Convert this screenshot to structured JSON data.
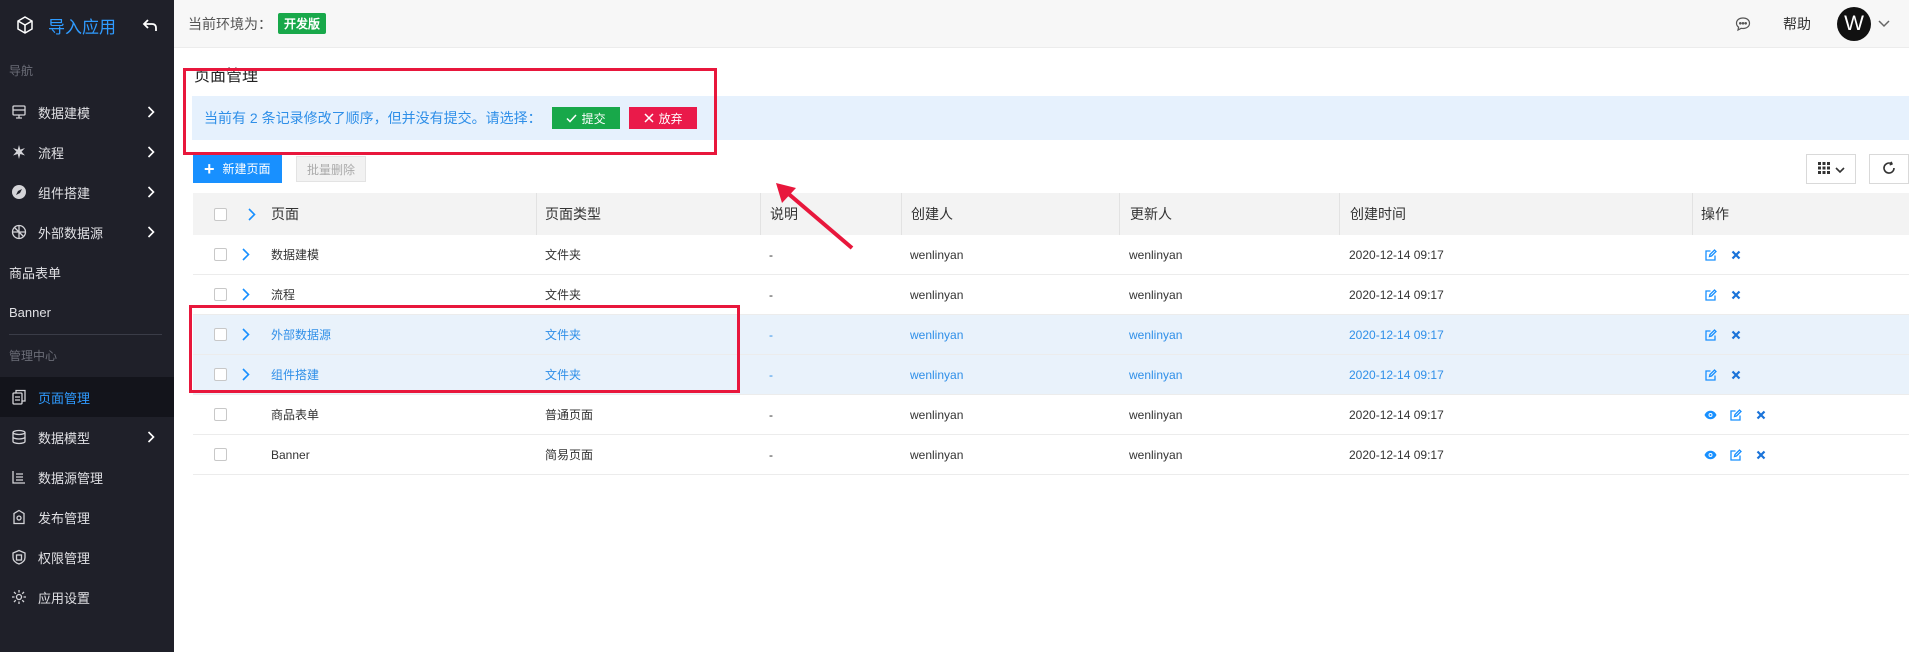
{
  "app": {
    "title": "导入应用"
  },
  "sidebar": {
    "nav_section": "导航",
    "nav_items": [
      {
        "label": "数据建模",
        "icon": "database-model-icon",
        "has_children": true
      },
      {
        "label": "流程",
        "icon": "flow-icon",
        "has_children": true
      },
      {
        "label": "组件搭建",
        "icon": "compass-icon",
        "has_children": true
      },
      {
        "label": "外部数据源",
        "icon": "external-source-icon",
        "has_children": true
      }
    ],
    "plain_items": [
      {
        "label": "商品表单"
      },
      {
        "label": "Banner"
      }
    ],
    "admin_section": "管理中心",
    "admin_items": [
      {
        "label": "页面管理",
        "icon": "pages-icon",
        "active": true,
        "has_children": false
      },
      {
        "label": "数据模型",
        "icon": "database-icon",
        "active": false,
        "has_children": true
      },
      {
        "label": "数据源管理",
        "icon": "datasource-icon",
        "active": false,
        "has_children": false
      },
      {
        "label": "发布管理",
        "icon": "publish-icon",
        "active": false,
        "has_children": false
      },
      {
        "label": "权限管理",
        "icon": "shield-icon",
        "active": false,
        "has_children": false
      },
      {
        "label": "应用设置",
        "icon": "gear-icon",
        "active": false,
        "has_children": false
      }
    ]
  },
  "topbar": {
    "env_label": "当前环境为：",
    "env_badge": "开发版",
    "help": "帮助",
    "avatar_initial": "W"
  },
  "page": {
    "title": "页面管理",
    "notice_text": "当前有 2 条记录修改了顺序，但并没有提交。请选择：",
    "submit_label": "提交",
    "discard_label": "放弃",
    "new_page_label": "新建页面",
    "batch_delete_label": "批量删除"
  },
  "colors": {
    "accent": "#1890ff",
    "submit": "#18a84a",
    "discard": "#ea1a4a",
    "annotation": "#e8173c",
    "sidebar_bg": "#1f2029"
  },
  "table": {
    "columns": [
      "页面",
      "页面类型",
      "说明",
      "创建人",
      "更新人",
      "创建时间",
      "操作"
    ],
    "rows": [
      {
        "name": "数据建模",
        "type": "文件夹",
        "desc": "-",
        "creator": "wenlinyan",
        "updater": "wenlinyan",
        "created": "2020-12-14 09:17",
        "expandable": true,
        "highlight": false,
        "actions": [
          "edit-icon",
          "delete-icon"
        ]
      },
      {
        "name": "流程",
        "type": "文件夹",
        "desc": "-",
        "creator": "wenlinyan",
        "updater": "wenlinyan",
        "created": "2020-12-14 09:17",
        "expandable": true,
        "highlight": false,
        "actions": [
          "edit-icon",
          "delete-icon"
        ]
      },
      {
        "name": "外部数据源",
        "type": "文件夹",
        "desc": "-",
        "creator": "wenlinyan",
        "updater": "wenlinyan",
        "created": "2020-12-14 09:17",
        "expandable": true,
        "highlight": true,
        "actions": [
          "edit-icon",
          "delete-icon"
        ]
      },
      {
        "name": "组件搭建",
        "type": "文件夹",
        "desc": "-",
        "creator": "wenlinyan",
        "updater": "wenlinyan",
        "created": "2020-12-14 09:17",
        "expandable": true,
        "highlight": true,
        "actions": [
          "edit-icon",
          "delete-icon"
        ]
      },
      {
        "name": "商品表单",
        "type": "普通页面",
        "desc": "-",
        "creator": "wenlinyan",
        "updater": "wenlinyan",
        "created": "2020-12-14 09:17",
        "expandable": false,
        "highlight": false,
        "actions": [
          "view-icon",
          "edit-icon",
          "delete-icon"
        ]
      },
      {
        "name": "Banner",
        "type": "简易页面",
        "desc": "-",
        "creator": "wenlinyan",
        "updater": "wenlinyan",
        "created": "2020-12-14 09:17",
        "expandable": false,
        "highlight": false,
        "actions": [
          "view-icon",
          "edit-icon",
          "delete-icon"
        ]
      }
    ]
  }
}
